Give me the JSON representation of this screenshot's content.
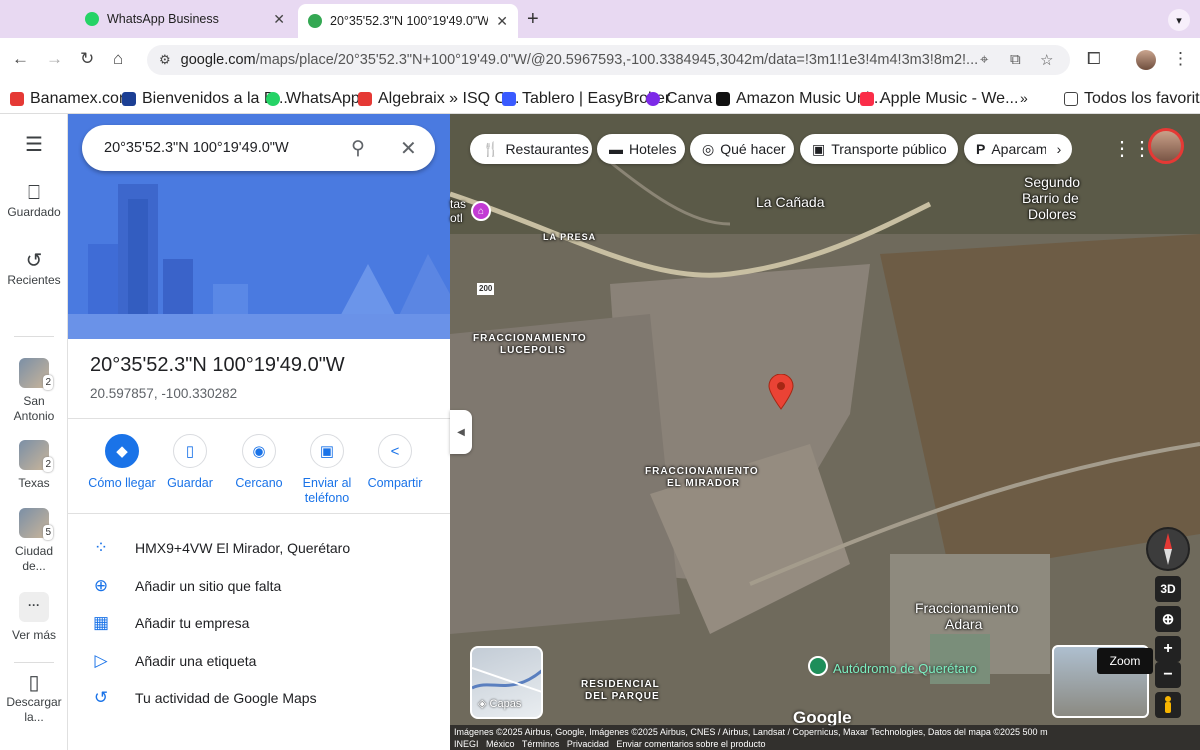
{
  "tabs": [
    {
      "title": "WhatsApp Business",
      "color": "#25d366"
    },
    {
      "title": "20°35'52.3\"N 100°19'49.0\"W",
      "color": "#34a853"
    }
  ],
  "url": {
    "host": "google.com",
    "path": "/maps/place/20°35'52.3\"N+100°19'49.0\"W/@20.5967593,-100.3384945,3042m/data=!3m1!1e3!4m4!3m3!8m2!..."
  },
  "bookmarks": [
    {
      "label": "Banamex.com",
      "color": "#e53935"
    },
    {
      "label": "Bienvenidos a la B...",
      "color": "#1c3f94"
    },
    {
      "label": "WhatsApp",
      "color": "#25d366"
    },
    {
      "label": "Algebraix » ISQ C...",
      "color": "#e53935"
    },
    {
      "label": "Tablero | EasyBroker",
      "color": "#3a5bff"
    },
    {
      "label": "Canva",
      "color": "#7d2ae8"
    },
    {
      "label": "Amazon Music Unl...",
      "color": "#111111"
    },
    {
      "label": "Apple Music - We...",
      "color": "#fa2d48"
    }
  ],
  "bookmarks_more": "»",
  "bookmarks_all": "Todos los favoritos",
  "rail": {
    "saved": "Guardado",
    "recent": "Recientes",
    "places": [
      {
        "label": "San Antonio",
        "count": "2"
      },
      {
        "label": "Texas",
        "count": "2"
      },
      {
        "label": "Ciudad de...",
        "count": "5"
      }
    ],
    "more": "Ver más",
    "download": "Descargar la..."
  },
  "search": {
    "value": "20°35'52.3\"N 100°19'49.0\"W"
  },
  "place": {
    "title": "20°35'52.3\"N 100°19'49.0\"W",
    "coords": "20.597857, -100.330282"
  },
  "actions": [
    {
      "label": "Cómo llegar",
      "icon": "◆"
    },
    {
      "label": "Guardar",
      "icon": "▯"
    },
    {
      "label": "Cercano",
      "icon": "◉"
    },
    {
      "label": "Enviar al teléfono",
      "icon": "▣"
    },
    {
      "label": "Compartir",
      "icon": "<"
    }
  ],
  "rows": [
    {
      "label": "HMX9+4VW El Mirador, Querétaro",
      "icon": "⁘"
    },
    {
      "label": "Añadir un sitio que falta",
      "icon": "⊕"
    },
    {
      "label": "Añadir tu empresa",
      "icon": "▦"
    },
    {
      "label": "Añadir una etiqueta",
      "icon": "▷"
    },
    {
      "label": "Tu actividad de Google Maps",
      "icon": "↺"
    }
  ],
  "chips": [
    {
      "label": "Restaurantes",
      "icon": "🍴"
    },
    {
      "label": "Hoteles",
      "icon": "▬"
    },
    {
      "label": "Qué hacer",
      "icon": "◎"
    },
    {
      "label": "Transporte público",
      "icon": "▣"
    },
    {
      "label": "Aparcam",
      "icon": "P"
    }
  ],
  "map_labels": [
    {
      "text": "La Cañada",
      "kind": "big"
    },
    {
      "text": "Segundo",
      "kind": "big"
    },
    {
      "text": "Barrio de",
      "kind": "big"
    },
    {
      "text": "Dolores",
      "kind": "big"
    },
    {
      "text": "LA PRESA",
      "kind": "small"
    },
    {
      "text": "FRACCIONAMIENTO",
      "kind": "small"
    },
    {
      "text": "LUCEPOLIS",
      "kind": "small"
    },
    {
      "text": "FRACCIONAMIENTO",
      "kind": "small"
    },
    {
      "text": "EL MIRADOR",
      "kind": "small"
    },
    {
      "text": "Fraccionamiento",
      "kind": "big"
    },
    {
      "text": "Adara",
      "kind": "big"
    },
    {
      "text": "RESIDENCIAL",
      "kind": "small"
    },
    {
      "text": "DEL PARQUE",
      "kind": "small"
    },
    {
      "text": "200",
      "kind": "small"
    },
    {
      "text": "tas",
      "kind": "small"
    },
    {
      "text": "otl",
      "kind": "small"
    }
  ],
  "poi": "Autódromo de Querétaro",
  "layers_label": "Capas",
  "map_controls": {
    "threeD": "3D",
    "zoom_in": "+",
    "zoom_out": "−",
    "zoom_tip": "Zoom"
  },
  "watermark": "Google",
  "attribution": {
    "line1": "Imágenes ©2025 Airbus, Google, Imágenes ©2025 Airbus, CNES / Airbus, Landsat / Copernicus, Maxar Technologies, Datos del mapa ©2025   500 m",
    "line2": "INEGI   México   Términos   Privacidad   Enviar comentarios sobre el producto"
  }
}
